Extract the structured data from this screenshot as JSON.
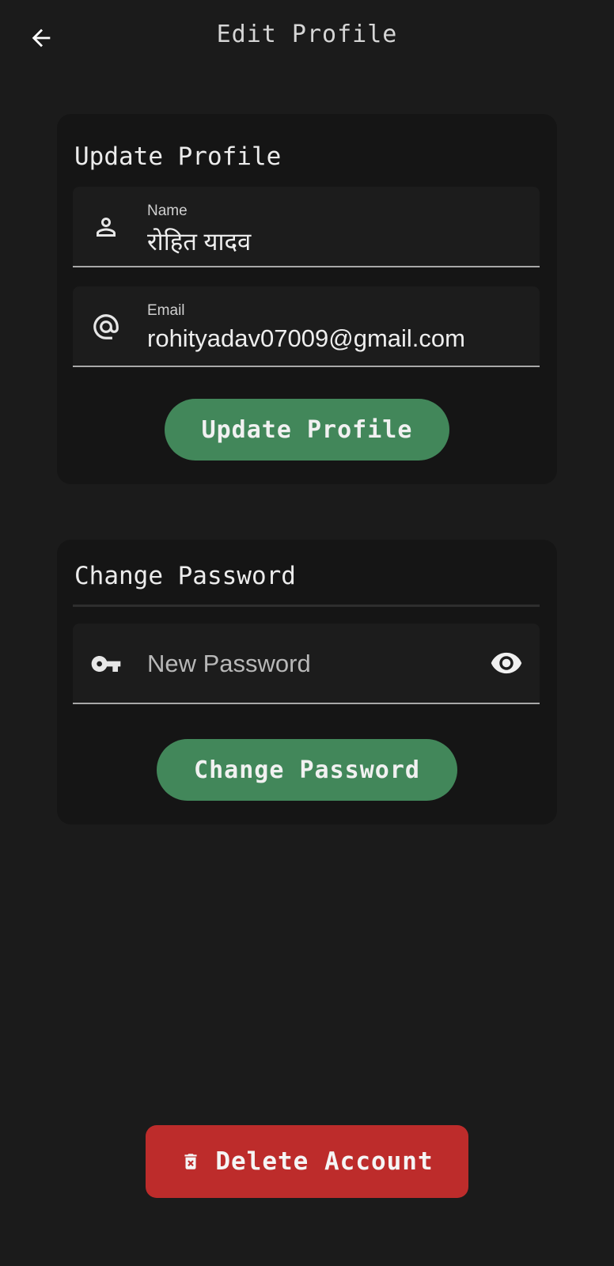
{
  "header": {
    "title": "Edit Profile",
    "back_icon": "arrow-left-icon"
  },
  "profile_card": {
    "title": "Update Profile",
    "name_field": {
      "label": "Name",
      "value": "रोहित यादव",
      "icon": "person-icon"
    },
    "email_field": {
      "label": "Email",
      "value": "rohityadav07009@gmail.com",
      "icon": "at-sign-icon"
    },
    "button_label": "Update Profile"
  },
  "password_card": {
    "title": "Change Password",
    "password_field": {
      "placeholder": "New Password",
      "icon": "key-icon",
      "toggle_icon": "eye-icon"
    },
    "button_label": "Change Password"
  },
  "delete_button": {
    "label": "Delete Account",
    "icon": "trash-icon"
  },
  "colors": {
    "background": "#1b1b1b",
    "card": "#151515",
    "accent_green": "#42875a",
    "danger_red": "#bd2c2b"
  }
}
